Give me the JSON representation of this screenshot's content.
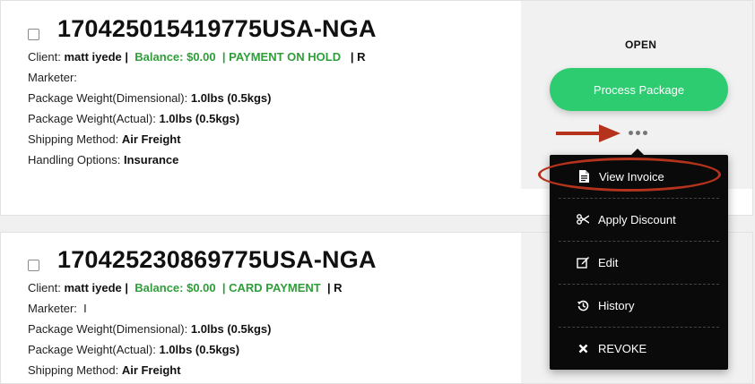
{
  "packages": [
    {
      "tracking": "170425015419775USA-NGA",
      "client_label": "Client:",
      "client_name": "matt iyede",
      "pipe1": "|",
      "balance": "Balance: $0.00",
      "payment_status": "| PAYMENT ON HOLD",
      "tail": "| R",
      "marketer_label": "Marketer:",
      "marketer_value": "",
      "dim_weight_label": "Package Weight(Dimensional):",
      "dim_weight_value": "1.0lbs (0.5kgs)",
      "act_weight_label": "Package Weight(Actual):",
      "act_weight_value": "1.0lbs (0.5kgs)",
      "shipping_label": "Shipping Method:",
      "shipping_value": "Air Freight",
      "handling_label": "Handling Options:",
      "handling_value": "Insurance",
      "status": "OPEN",
      "process_label": "Process Package"
    },
    {
      "tracking": "170425230869775USA-NGA",
      "client_label": "Client:",
      "client_name": "matt iyede",
      "pipe1": "|",
      "balance": "Balance: $0.00",
      "payment_status": "| CARD PAYMENT",
      "tail": "| R",
      "marketer_label": "Marketer:",
      "marketer_value": "I",
      "dim_weight_label": "Package Weight(Dimensional):",
      "dim_weight_value": "1.0lbs (0.5kgs)",
      "act_weight_label": "Package Weight(Actual):",
      "act_weight_value": "1.0lbs (0.5kgs)",
      "shipping_label": "Shipping Method:",
      "shipping_value": "Air Freight"
    }
  ],
  "menu": {
    "items": [
      {
        "label": "View Invoice",
        "icon": "document-icon"
      },
      {
        "label": "Apply Discount",
        "icon": "scissors-icon"
      },
      {
        "label": "Edit",
        "icon": "edit-icon"
      },
      {
        "label": "History",
        "icon": "history-icon"
      },
      {
        "label": "REVOKE",
        "icon": "close-icon"
      }
    ]
  },
  "colors": {
    "accent_green": "#2ecc71",
    "balance_green": "#2f9e3a",
    "annotation_red": "#b5331c",
    "menu_bg": "#0a0a0a"
  }
}
